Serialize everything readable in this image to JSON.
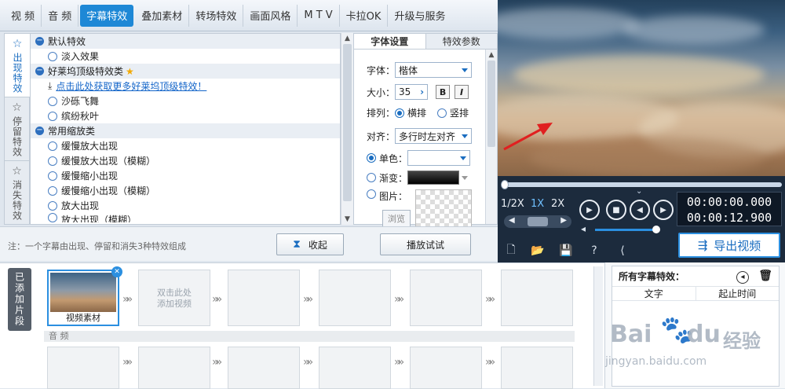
{
  "top_tabs": [
    "视 频",
    "音 频",
    "字幕特效",
    "叠加素材",
    "转场特效",
    "画面风格",
    "M T V",
    "卡拉OK",
    "升级与服务"
  ],
  "side_tabs": [
    "出现特效",
    "停留特效",
    "消失特效"
  ],
  "effects": {
    "cat1": "默认特效",
    "cat1_items": [
      "淡入效果"
    ],
    "cat2": "好莱坞顶级特效类",
    "cat2_link": "点击此处获取更多好莱坞顶级特效！",
    "cat2_items": [
      "沙砾飞舞",
      "缤纷秋叶"
    ],
    "cat3": "常用缩放类",
    "cat3_items": [
      "缓慢放大出现",
      "缓慢放大出现（模糊）",
      "缓慢缩小出现",
      "缓慢缩小出现（模糊）",
      "放大出现",
      "放大出现（模糊）"
    ]
  },
  "settings": {
    "tab_font": "字体设置",
    "tab_params": "特效参数",
    "font_label": "字体：",
    "font_value": "楷体",
    "size_label": "大小：",
    "size_value": "35",
    "bold": "B",
    "italic": "I",
    "arrange_label": "排列：",
    "arrange_h": "横排",
    "arrange_v": "竖排",
    "align_label": "对齐：",
    "align_value": "多行时左对齐",
    "color_single": "单色：",
    "color_gradient": "渐变：",
    "color_image": "图片：",
    "browse": "浏览"
  },
  "left_bottom": {
    "note": "注：一个字幕由出现、停留和消失3种特效组成",
    "collapse": "收起",
    "preview_btn": "播放试试"
  },
  "player": {
    "speeds": [
      "1/2X",
      "1X",
      "2X"
    ],
    "time_current": "00:00:00.000",
    "time_total": "00:00:12.900",
    "export": "导出视频"
  },
  "clips": {
    "added_label": "已添加片段",
    "clip1_label": "视频素材",
    "add_hint_1": "双击此处",
    "add_hint_2": "添加视频",
    "audio_label": "音 频"
  },
  "fx_panel": {
    "title": "所有字幕特效：",
    "col_text": "文字",
    "col_time": "起止时间"
  },
  "watermark": {
    "brand": "Bai",
    "brand2": "du",
    "cn": "经验",
    "url": "jingyan.baidu.com"
  }
}
